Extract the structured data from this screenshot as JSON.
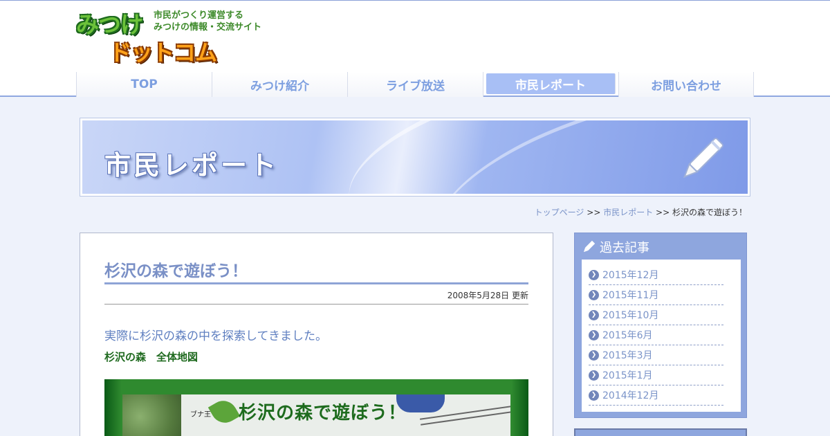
{
  "logo": {
    "top": "みつけ",
    "bottom": "ドットコム",
    "tagline_line1": "市民がつくり運営する",
    "tagline_line2": "みつけの情報・交流サイト"
  },
  "nav": {
    "items": [
      "TOP",
      "みつけ紹介",
      "ライブ放送",
      "市民レポート",
      "お問い合わせ"
    ],
    "active": "市民レポート"
  },
  "banner": {
    "title": "市民レポート"
  },
  "breadcrumb": {
    "home": "トップページ",
    "sep": ">>",
    "section": "市民レポート",
    "current": "杉沢の森で遊ぼう！"
  },
  "article": {
    "title": "杉沢の森で遊ぼう！",
    "date": "2008年5月28日 更新",
    "lead": "実際に杉沢の森の中を探索してきました。",
    "subheading": "杉沢の森　全体地図",
    "map_title": "杉沢の森で遊ぼう！",
    "map_label": "ブナ王"
  },
  "sidebar": {
    "heading": "過去記事",
    "items": [
      "2015年12月",
      "2015年11月",
      "2015年10月",
      "2015年6月",
      "2015年3月",
      "2015年1月",
      "2014年12月"
    ]
  },
  "colors": {
    "accent": "#7d9fe0",
    "nav_active": "#a8bff5",
    "sidebar": "#8ea6de",
    "green": "#1f6a1f"
  }
}
